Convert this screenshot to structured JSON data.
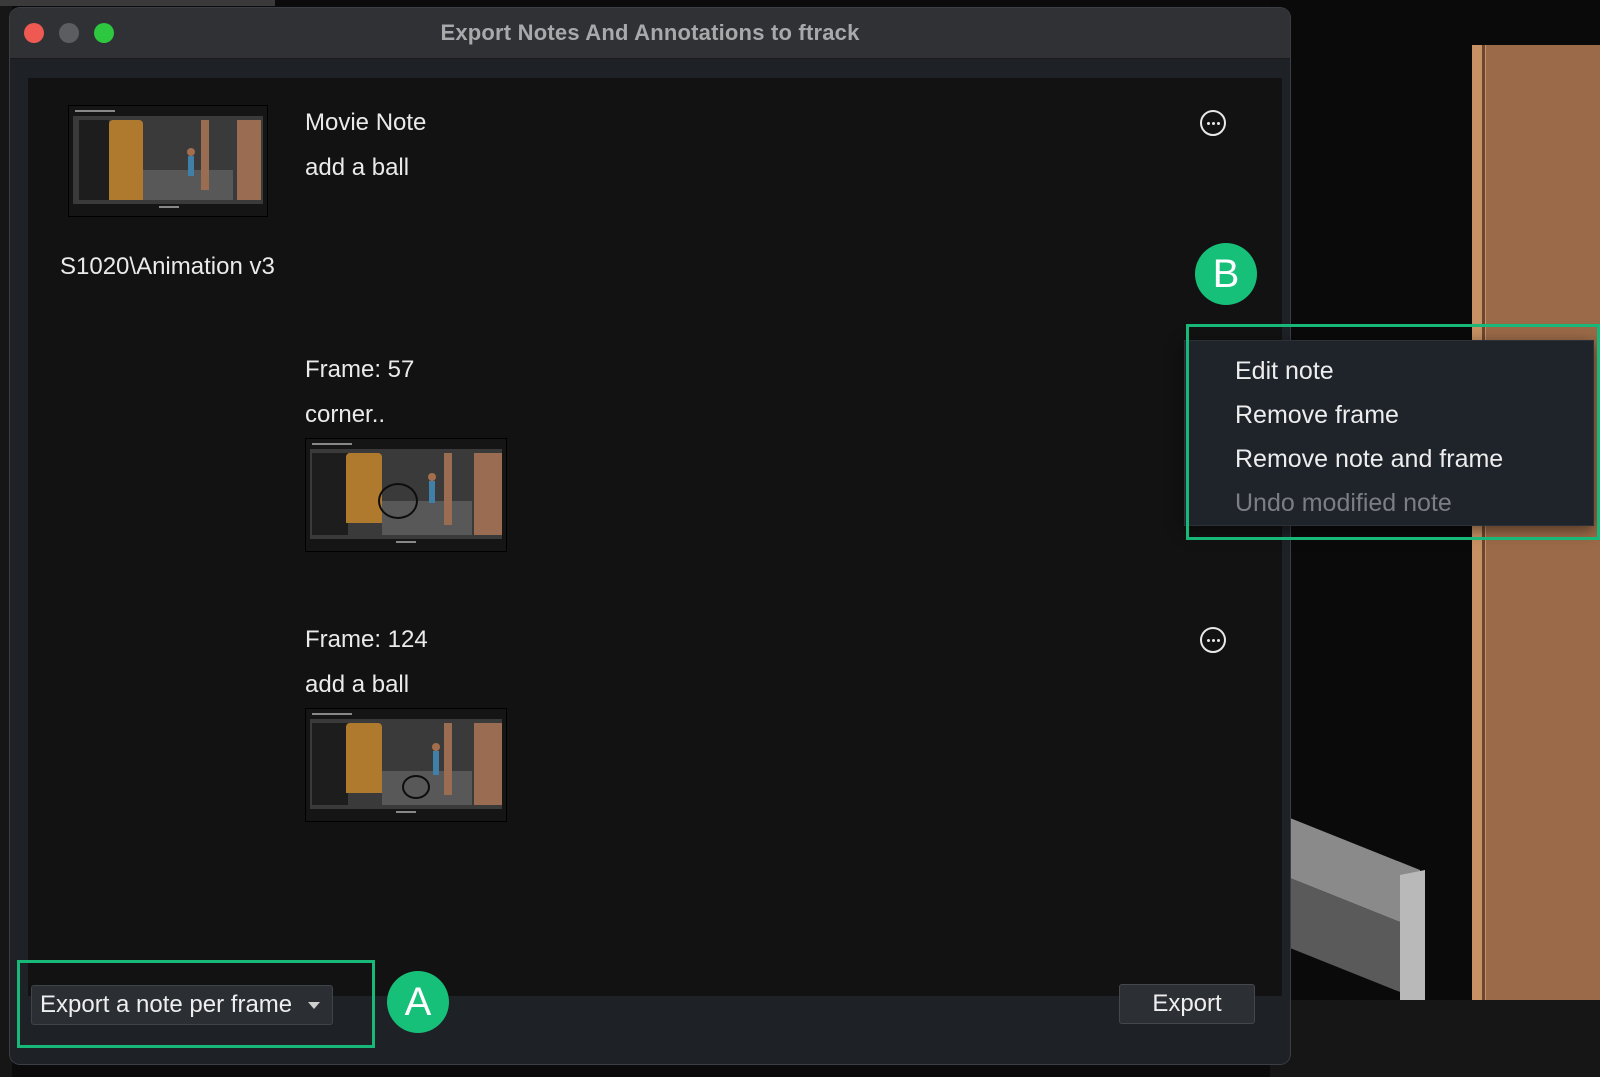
{
  "window": {
    "title": "Export Notes And Annotations to ftrack"
  },
  "version": {
    "label": "S1020\\Animation v3"
  },
  "notes": [
    {
      "header": "Movie Note",
      "text": "add a ball"
    },
    {
      "header": "Frame: 57",
      "text": "corner.."
    },
    {
      "header": "Frame: 124",
      "text": "add a ball"
    }
  ],
  "context_menu": {
    "items": [
      {
        "label": "Edit note",
        "enabled": true
      },
      {
        "label": "Remove frame",
        "enabled": true
      },
      {
        "label": "Remove note and frame",
        "enabled": true
      },
      {
        "label": "Undo modified note",
        "enabled": false
      }
    ]
  },
  "footer": {
    "mode_select": {
      "selected": "Export a note per frame"
    },
    "export_label": "Export"
  },
  "callouts": {
    "a": "A",
    "b": "B"
  },
  "colors": {
    "accent": "#16c079",
    "window_bg": "#1e2227",
    "content_bg": "#121212"
  }
}
